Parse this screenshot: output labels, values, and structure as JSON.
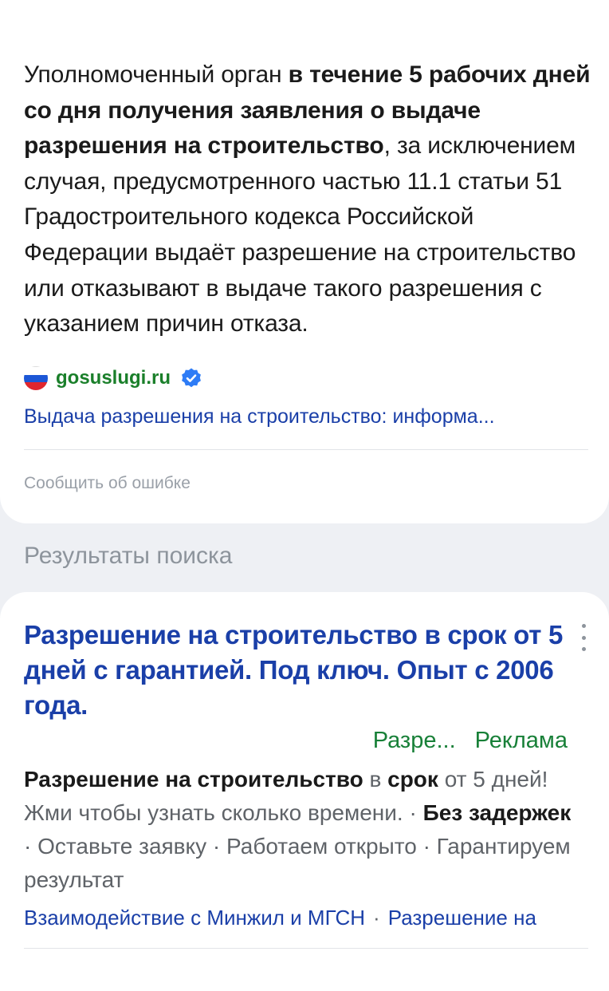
{
  "answer_card": {
    "text_1": "Уполномоченный орган ",
    "text_bold": "в течение 5 рабочих дней со дня получения заявления о выдаче разрешения на строительство",
    "text_2": ", за исключением случая, предусмотренного частью 11.1 статьи 51 Градостроительного кодекса Российской Федерации выдаёт разрешение на строительство или отказывают в выдаче такого разрешения с указанием причин отказа.",
    "source_domain": "gosuslugi.ru",
    "source_icon": "russian-flag-icon",
    "verified_icon": "verified-check-icon",
    "source_link": "Выдача разрешения на строительство: информа...",
    "report_error": "Сообщить об ошибке"
  },
  "search_results": {
    "section_title": "Результаты поиска",
    "items": [
      {
        "title": "Разрешение на строительство в срок от 5 дней с гарантией. Под ключ. Опыт с 2006 года.",
        "menu_icon": "more-vertical-icon",
        "display_url": "Разре...",
        "ad_label": "Реклама",
        "snippet": {
          "b1": "Разрешение на строительство",
          "t1": " в ",
          "b2": "срок",
          "t2": " от 5 дней! Жми чтобы узнать сколько времени. · ",
          "b3": "Без задержек",
          "t3": " · Оставьте заявку · Работаем открыто · Гарантируем результат"
        },
        "sitelinks": [
          "Взаимодействие с Минжил и МГСН",
          "Разрешение на"
        ]
      }
    ]
  },
  "colors": {
    "link_blue": "#1a3fa8",
    "domain_green": "#1a7f2a",
    "ad_green": "#188038",
    "muted_gray": "#9aa0a8",
    "background": "#eef0f4"
  }
}
